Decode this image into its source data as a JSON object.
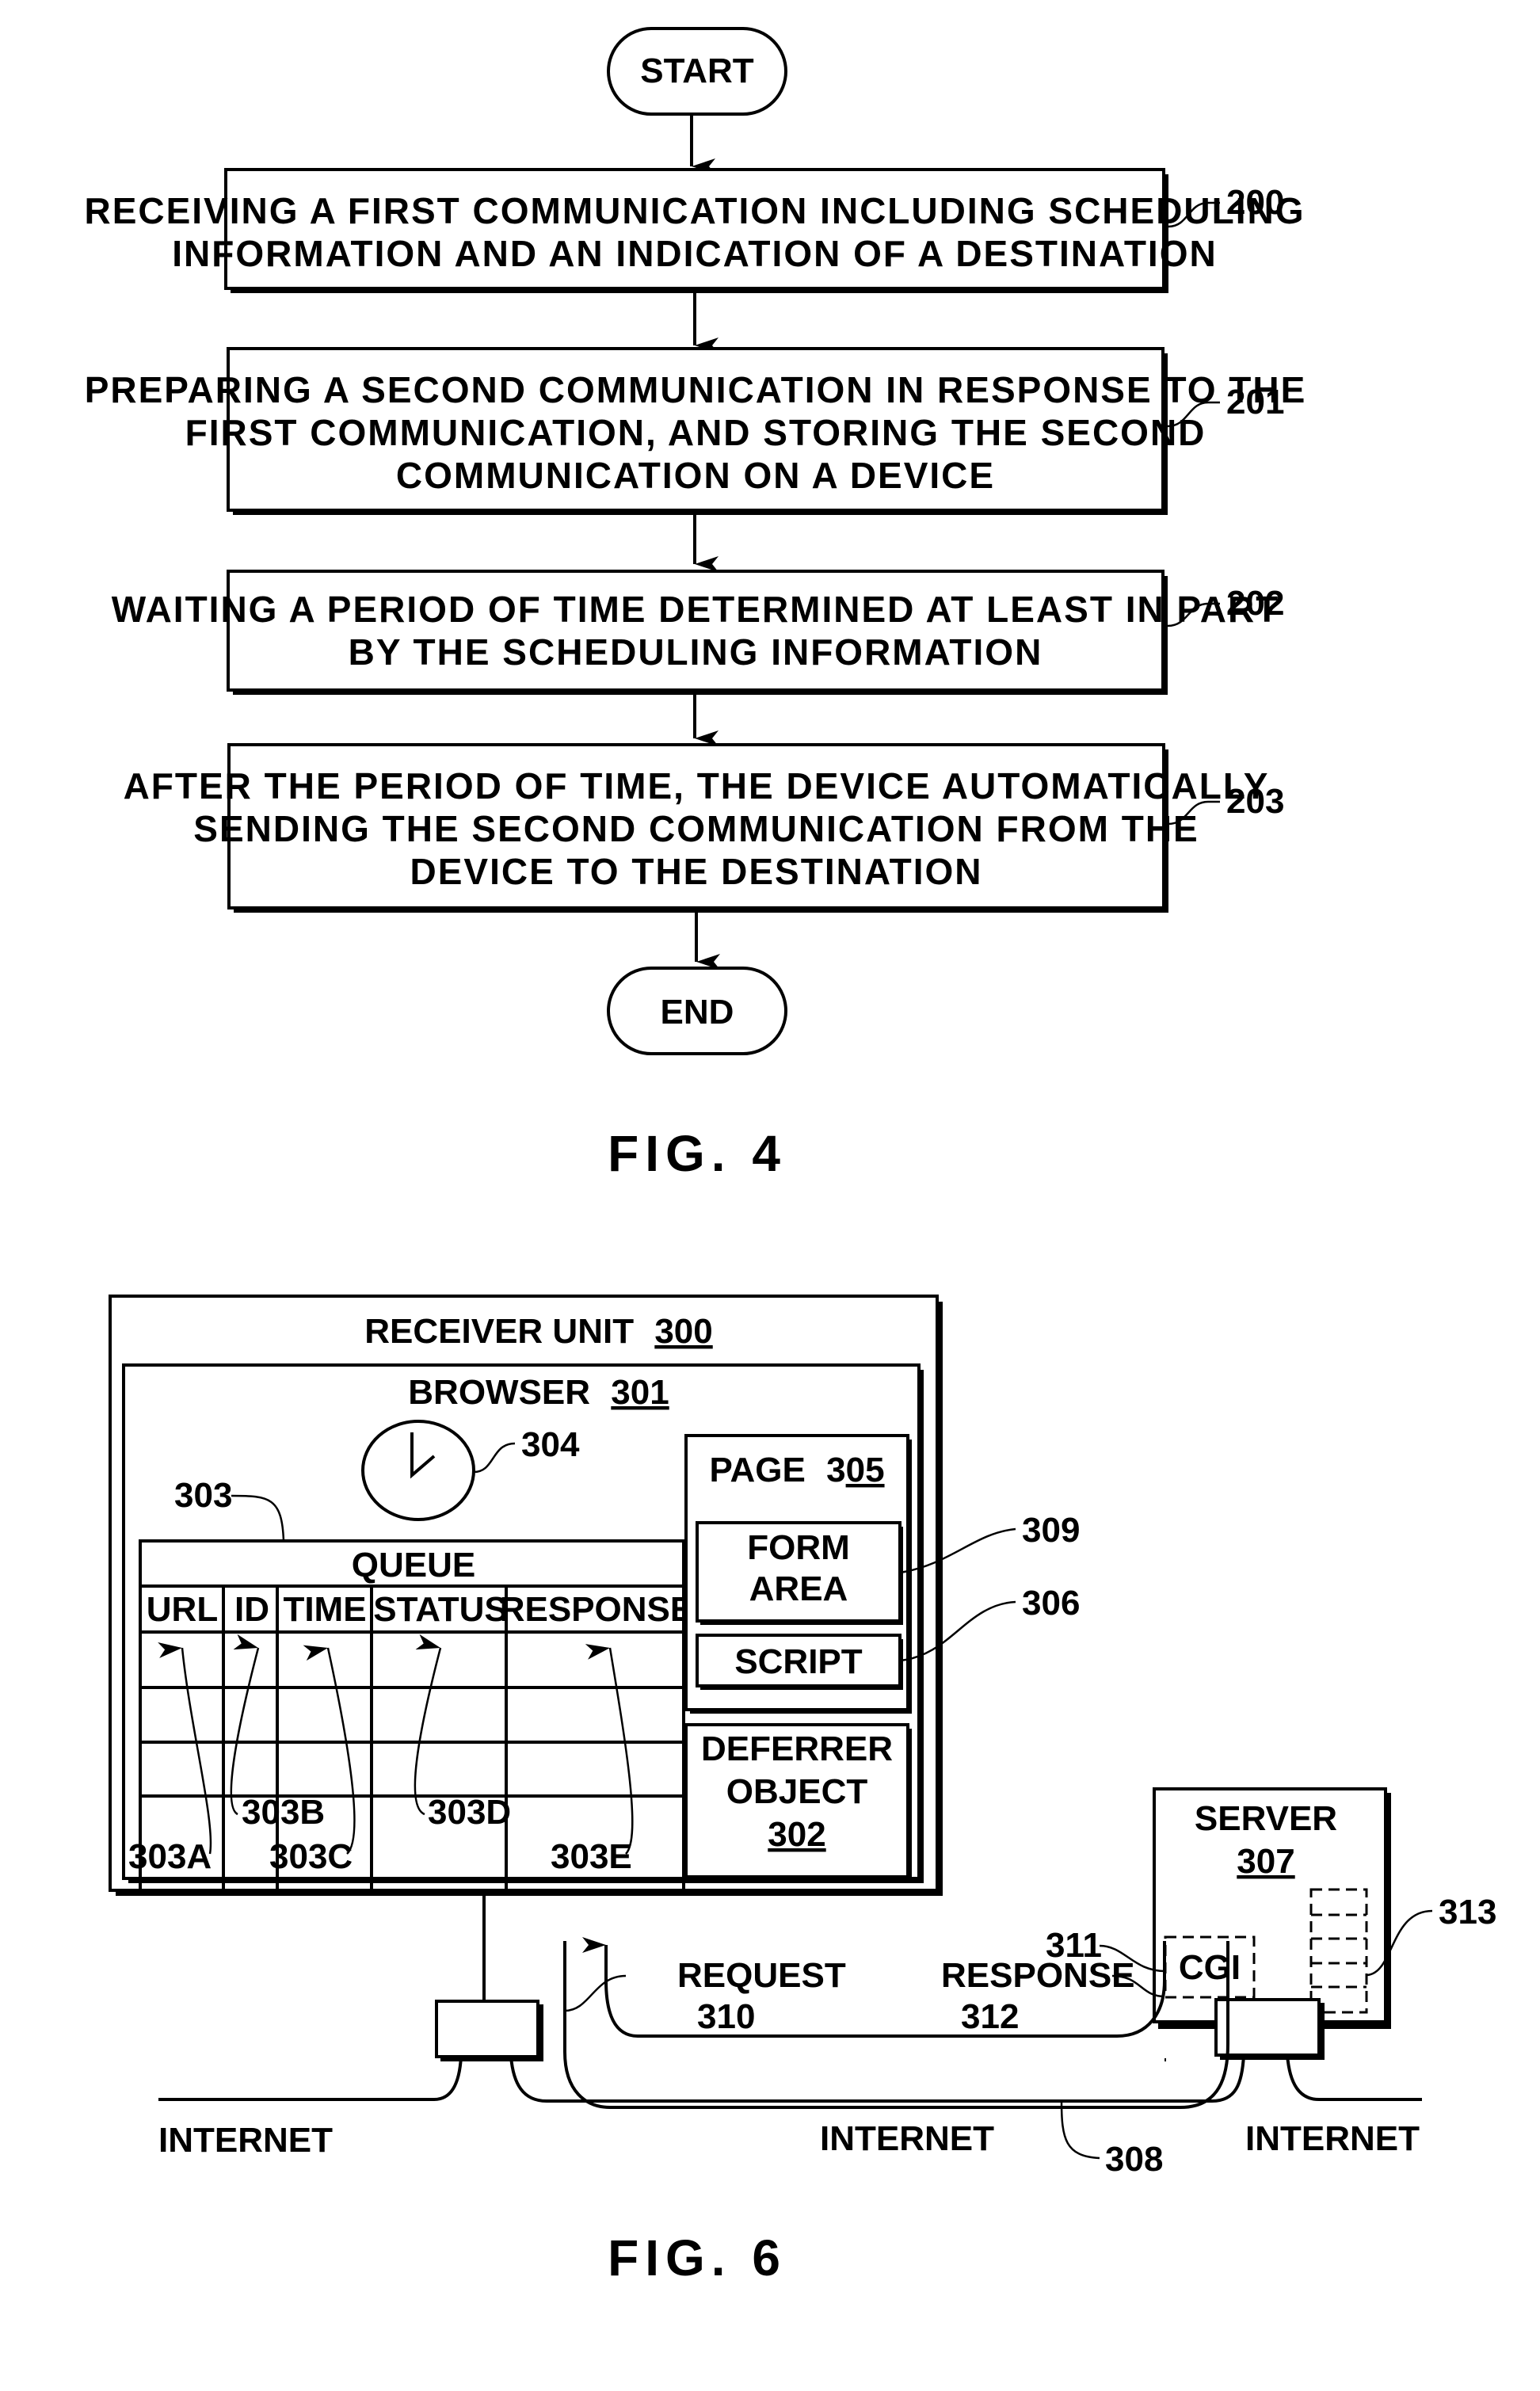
{
  "fig4": {
    "caption": "FIG. 4",
    "start_label": "START",
    "end_label": "END",
    "steps": [
      {
        "ref": "200",
        "lines": [
          "RECEIVING A FIRST COMMUNICATION INCLUDING SCHEDULING",
          "INFORMATION AND AN INDICATION OF A DESTINATION"
        ]
      },
      {
        "ref": "201",
        "lines": [
          "PREPARING A SECOND COMMUNICATION IN RESPONSE TO THE",
          "FIRST COMMUNICATION, AND STORING THE SECOND",
          "COMMUNICATION ON A DEVICE"
        ]
      },
      {
        "ref": "202",
        "lines": [
          "WAITING A PERIOD OF TIME DETERMINED AT LEAST IN PART",
          "BY THE SCHEDULING INFORMATION"
        ]
      },
      {
        "ref": "203",
        "lines": [
          "AFTER THE PERIOD OF TIME, THE DEVICE AUTOMATICALLY",
          "SENDING THE SECOND COMMUNICATION FROM THE",
          "DEVICE TO THE DESTINATION"
        ]
      }
    ]
  },
  "fig6": {
    "caption": "FIG. 6",
    "receiver_unit": {
      "label": "RECEIVER UNIT",
      "ref": "300"
    },
    "browser": {
      "label": "BROWSER",
      "ref": "301"
    },
    "clock": {
      "ref": "304"
    },
    "queue": {
      "ref": "303",
      "title": "QUEUE",
      "columns": [
        "URL",
        "ID",
        "TIME",
        "STATUS",
        "RESPONSE"
      ],
      "column_refs": [
        "303A",
        "303B",
        "303C",
        "303D",
        "303E"
      ],
      "empty_rows": 4
    },
    "page": {
      "label": "PAGE",
      "ref_prefix": "3",
      "ref_underlined": "05"
    },
    "form_area": {
      "lines": [
        "FORM",
        "AREA"
      ],
      "ref": "309"
    },
    "script": {
      "label": "SCRIPT",
      "ref": "306"
    },
    "deferrer": {
      "lines": [
        "DEFERRER",
        "OBJECT"
      ],
      "ref": "302"
    },
    "server": {
      "label": "SERVER",
      "ref": "307"
    },
    "cgi": {
      "label": "CGI",
      "ref": "311"
    },
    "storage": {
      "ref": "313"
    },
    "request": {
      "label": "REQUEST",
      "ref": "310"
    },
    "response": {
      "label": "RESPONSE",
      "ref": "312"
    },
    "internet": {
      "label": "INTERNET",
      "ref": "308"
    }
  }
}
